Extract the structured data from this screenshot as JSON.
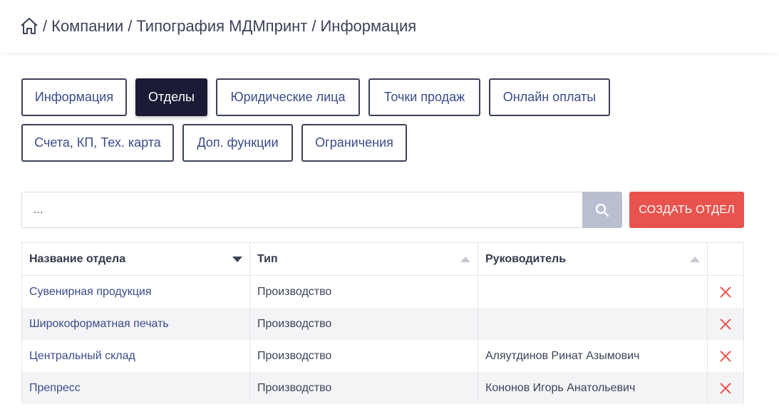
{
  "breadcrumb": {
    "home_icon": "home-icon",
    "items": [
      "Компании",
      "Типография МДМпринт",
      "Информация"
    ],
    "separator": "/"
  },
  "tabs": [
    {
      "label": "Информация",
      "active": false
    },
    {
      "label": "Отделы",
      "active": true
    },
    {
      "label": "Юридические лица",
      "active": false
    },
    {
      "label": "Точки продаж",
      "active": false
    },
    {
      "label": "Онлайн оплаты",
      "active": false
    },
    {
      "label": "Счета, КП, Тех. карта",
      "active": false
    },
    {
      "label": "Доп. функции",
      "active": false
    },
    {
      "label": "Ограничения",
      "active": false
    }
  ],
  "search": {
    "placeholder": "...",
    "value": "",
    "icon": "search-icon"
  },
  "create_button": {
    "label": "СОЗДАТЬ ОТДЕЛ",
    "color": "#e8534e"
  },
  "table": {
    "columns": [
      {
        "label": "Название отдела",
        "sort": "desc"
      },
      {
        "label": "Тип",
        "sort": "asc"
      },
      {
        "label": "Руководитель",
        "sort": "asc"
      },
      {
        "label": ""
      }
    ],
    "rows": [
      {
        "name": "Сувенирная продукция",
        "type": "Производство",
        "head": ""
      },
      {
        "name": "Широкоформатная печать",
        "type": "Производство",
        "head": ""
      },
      {
        "name": "Центральный склад",
        "type": "Производство",
        "head": "Аляутдинов Ринат Азымович"
      },
      {
        "name": "Препресс",
        "type": "Производство",
        "head": "Кононов Игорь Анатольевич"
      }
    ],
    "delete_icon": "close-icon"
  },
  "colors": {
    "active_tab": "#1b1b36",
    "link": "#3b4b8a",
    "delete": "#e8534e",
    "search_button": "#b9bfd0"
  }
}
